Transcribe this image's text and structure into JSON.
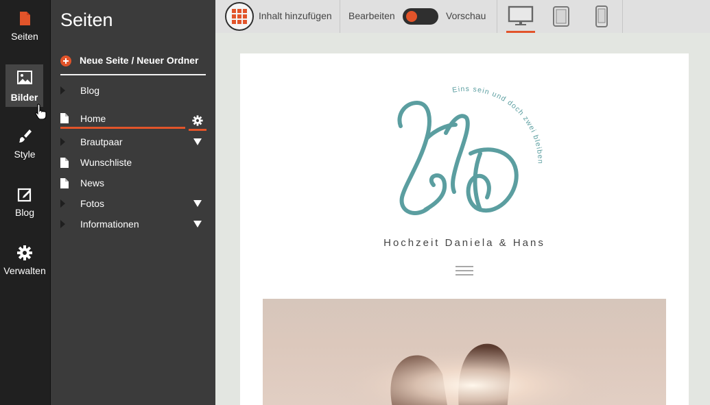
{
  "rail": {
    "items": [
      {
        "label": "Seiten",
        "icon": "page-icon"
      },
      {
        "label": "Bilder",
        "icon": "image-icon"
      },
      {
        "label": "Style",
        "icon": "brush-icon"
      },
      {
        "label": "Blog",
        "icon": "edit-icon"
      },
      {
        "label": "Verwalten",
        "icon": "gear-icon"
      }
    ]
  },
  "panel": {
    "title": "Seiten",
    "new_page_label": "Neue Seite / Neuer Ordner",
    "items": [
      {
        "label": "Blog",
        "type": "folder"
      },
      {
        "label": "Home",
        "type": "page"
      },
      {
        "label": "Brautpaar",
        "type": "folder"
      },
      {
        "label": "Wunschliste",
        "type": "page"
      },
      {
        "label": "News",
        "type": "page"
      },
      {
        "label": "Fotos",
        "type": "folder"
      },
      {
        "label": "Informationen",
        "type": "folder"
      }
    ]
  },
  "toolbar": {
    "add_content_label": "Inhalt hinzufügen",
    "edit_label": "Bearbeiten",
    "preview_label": "Vorschau"
  },
  "site": {
    "logo_curved_text": "Eins sein und doch zwei bleiben",
    "title": "Hochzeit Daniela & Hans"
  },
  "colors": {
    "accent": "#e2542a",
    "logo": "#5b9ea0",
    "rail_bg": "#202020",
    "panel_bg": "#3b3b3b"
  }
}
